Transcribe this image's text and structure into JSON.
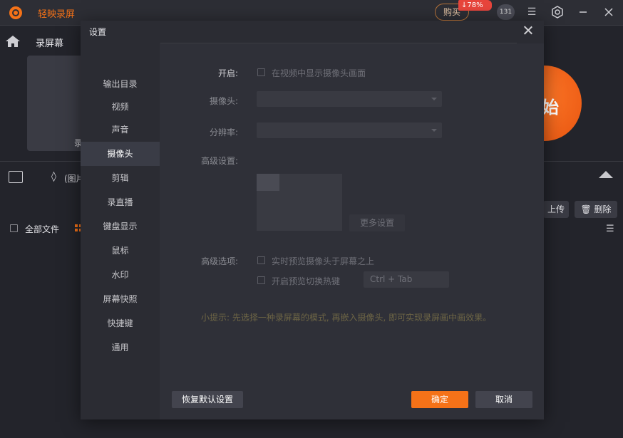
{
  "app": {
    "name": "轻映录屏",
    "buy_label": "购买",
    "discount": "78%",
    "count": "131",
    "brand_color": "#f57218"
  },
  "background": {
    "section_title": "录屏幕",
    "mode_card_label": "录",
    "start_label": "始",
    "drop_label": "(图片",
    "upload_label": "上传",
    "delete_label": "删除",
    "all_files_label": "全部文件"
  },
  "modal": {
    "title": "设置",
    "sidebar": [
      {
        "label": "输出目录"
      },
      {
        "label": "视频"
      },
      {
        "label": "声音"
      },
      {
        "label": "摄像头",
        "active": true
      },
      {
        "label": "剪辑"
      },
      {
        "label": "录直播"
      },
      {
        "label": "键盘显示"
      },
      {
        "label": "鼠标"
      },
      {
        "label": "水印"
      },
      {
        "label": "屏幕快照"
      },
      {
        "label": "快捷键"
      },
      {
        "label": "通用"
      }
    ],
    "camera": {
      "enable_label": "开启:",
      "enable_checkbox": "在视频中显示摄像头画面",
      "camera_label": "摄像头:",
      "camera_value": "",
      "resolution_label": "分辨率:",
      "resolution_value": "",
      "advanced_settings_label": "高级设置:",
      "more_settings": "更多设置",
      "advanced_options_label": "高级选项:",
      "option_preview_on_top": "实时预览摄像头于屏幕之上",
      "option_hotkey": "开启预览切换热键",
      "hotkey_value": "Ctrl + Tab",
      "tip": "小提示: 先选择一种录屏幕的模式, 再嵌入摄像头, 即可实现录屏画中画效果。"
    },
    "buttons": {
      "reset": "恢复默认设置",
      "ok": "确定",
      "cancel": "取消"
    }
  }
}
